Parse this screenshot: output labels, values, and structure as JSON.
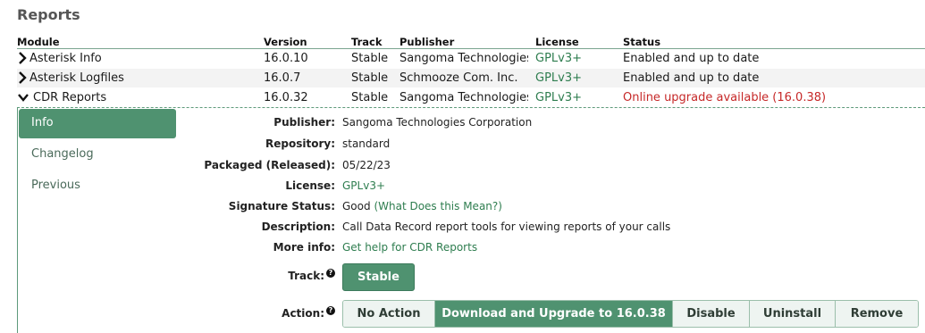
{
  "section": {
    "title": "Reports"
  },
  "columns": {
    "module": "Module",
    "version": "Version",
    "track": "Track",
    "publisher": "Publisher",
    "license": "License",
    "status": "Status"
  },
  "modules": [
    {
      "name": "Asterisk Info",
      "version": "16.0.10",
      "track": "Stable",
      "publisher": "Sangoma Technologies Corporation",
      "license": "GPLv3+",
      "status": "Enabled and up to date",
      "expanded": false
    },
    {
      "name": "Asterisk Logfiles",
      "version": "16.0.7",
      "track": "Stable",
      "publisher": "Schmooze Com. Inc.",
      "license": "GPLv3+",
      "status": "Enabled and up to date",
      "expanded": false
    },
    {
      "name": "CDR Reports",
      "version": "16.0.32",
      "track": "Stable",
      "publisher": "Sangoma Technologies Corporation",
      "license": "GPLv3+",
      "status": "Online upgrade available (16.0.38)",
      "expanded": true
    }
  ],
  "sidebar": {
    "items": [
      {
        "label": "Info",
        "active": true
      },
      {
        "label": "Changelog",
        "active": false
      },
      {
        "label": "Previous",
        "active": false
      }
    ]
  },
  "details": {
    "publisher_label": "Publisher:",
    "publisher": "Sangoma Technologies Corporation",
    "repository_label": "Repository:",
    "repository": "standard",
    "packaged_label": "Packaged (Released):",
    "packaged": "05/22/23",
    "license_label": "License:",
    "license": "GPLv3+",
    "signature_label": "Signature Status:",
    "signature": "Good",
    "signature_link": "(What Does this Mean?)",
    "description_label": "Description:",
    "description": "Call Data Record report tools for viewing reports of your calls",
    "moreinfo_label": "More info:",
    "moreinfo": "Get help for CDR Reports",
    "track_label": "Track:",
    "track_button": "Stable",
    "action_label": "Action:",
    "actions": [
      "No Action",
      "Download and Upgrade to 16.0.38",
      "Disable",
      "Uninstall",
      "Remove"
    ]
  },
  "colors": {
    "accent": "#4f9270",
    "link": "#2e7d4f",
    "warning": "#c62828"
  },
  "icons": {
    "collapsed": "chevron-right-icon",
    "expanded": "chevron-down-icon",
    "help": "help-circle-icon"
  }
}
